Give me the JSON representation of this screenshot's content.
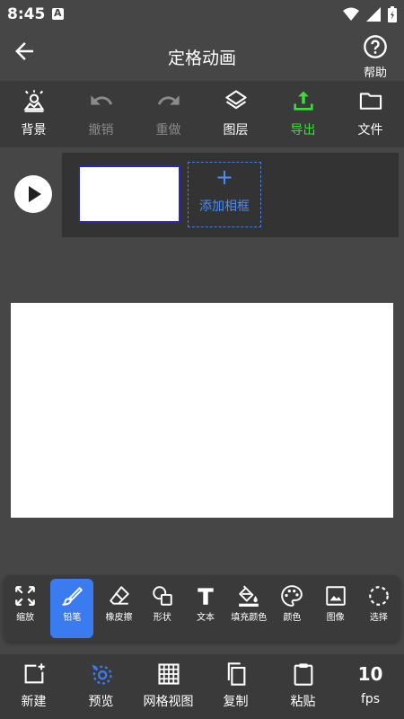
{
  "status": {
    "time": "8:45"
  },
  "app_bar": {
    "title": "定格动画",
    "help_label": "帮助"
  },
  "toolbar": {
    "background": "背景",
    "undo": "撤销",
    "redo": "重做",
    "layers": "图层",
    "export": "导出",
    "file": "文件"
  },
  "frames": {
    "add_frame": "添加相框"
  },
  "tools": {
    "zoom": "缩放",
    "pencil": "铅笔",
    "eraser": "橡皮擦",
    "shape": "形状",
    "text": "文本",
    "fill": "填充颜色",
    "color": "颜色",
    "image": "图像",
    "select": "选择"
  },
  "bottom_bar": {
    "new": "新建",
    "preview": "预览",
    "grid_view": "网格视图",
    "copy": "复制",
    "paste": "粘贴",
    "fps_value": "10",
    "fps_label": "fps"
  },
  "colors": {
    "accent_blue": "#3a7cf0",
    "export_green": "#3ddc3d"
  }
}
